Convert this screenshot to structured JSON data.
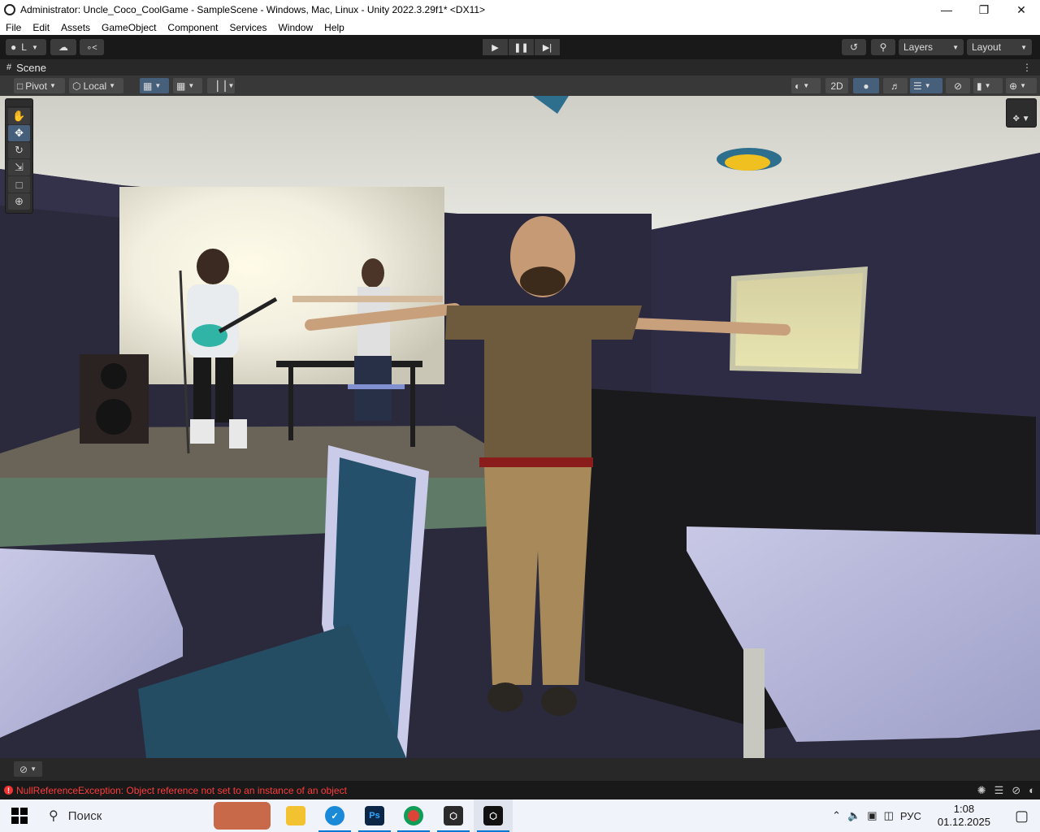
{
  "window": {
    "title": "Administrator: Uncle_Coco_CoolGame - SampleScene - Windows, Mac, Linux - Unity 2022.3.29f1* <DX11>",
    "min_icon": "minimize-icon",
    "restore_icon": "restore-icon",
    "close_icon": "close-icon"
  },
  "menu": [
    "File",
    "Edit",
    "Assets",
    "GameObject",
    "Component",
    "Services",
    "Window",
    "Help"
  ],
  "toolbar": {
    "account_label": "L",
    "layers_label": "Layers",
    "layout_label": "Layout"
  },
  "scene_tab": {
    "label": "Scene"
  },
  "scene_toolbar": {
    "pivot_label": "Pivot",
    "local_label": "Local",
    "mode_2d_label": "2D"
  },
  "status": {
    "error_message": "NullReferenceException: Object reference not set to an instance of an object"
  },
  "taskbar": {
    "search_placeholder": "Поиск",
    "language": "РУС",
    "time": "1:08",
    "date": "01.12.2025"
  },
  "colors": {
    "editor_dark": "#191919",
    "panel": "#282828",
    "scene_toolbar": "#383838",
    "accent_blue": "#46607c",
    "error_red": "#ff3c3c"
  }
}
